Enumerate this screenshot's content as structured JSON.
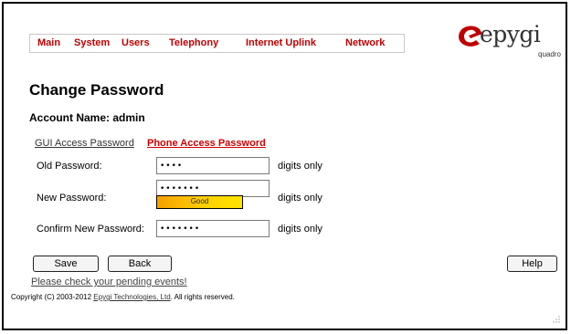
{
  "menu": {
    "items": [
      "Main",
      "System",
      "Users",
      "Telephony",
      "Internet Uplink",
      "Network"
    ]
  },
  "logo": {
    "brand": "epygi",
    "sub": "quadro",
    "icon": "epygi-logo-icon",
    "accent_color": "#c00000"
  },
  "page": {
    "title": "Change Password",
    "account_label": "Account Name:",
    "account_name": "admin"
  },
  "tabs": {
    "gui_label": "GUI Access Password",
    "phone_label": "Phone Access Password",
    "active": "Phone Access Password"
  },
  "form": {
    "old_password": {
      "label": "Old Password:",
      "value": "••••",
      "hint": "digits only"
    },
    "new_password": {
      "label": "New Password:",
      "value": "•••••••",
      "hint": "digits only"
    },
    "confirm_password": {
      "label": "Confirm New Password:",
      "value": "•••••••",
      "hint": "digits only"
    },
    "strength": {
      "label": "Good",
      "color": "#ffcc00"
    }
  },
  "buttons": {
    "save": "Save",
    "back": "Back",
    "help": "Help"
  },
  "footer": {
    "pending_link": "Please check your pending events!",
    "copyright_prefix": "Copyright (C) 2003-2012",
    "copyright_company": "Epygi Technologies, Ltd",
    "copyright_suffix": ". All rights reserved."
  }
}
